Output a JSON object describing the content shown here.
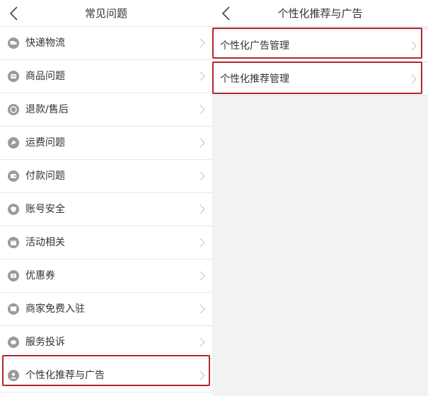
{
  "left": {
    "title": "常见问题",
    "items": [
      {
        "label": "快递物流",
        "icon": "truck-icon"
      },
      {
        "label": "商品问题",
        "icon": "product-icon"
      },
      {
        "label": "退款/售后",
        "icon": "refund-icon"
      },
      {
        "label": "运费问题",
        "icon": "shipping-fee-icon"
      },
      {
        "label": "付款问题",
        "icon": "wallet-icon"
      },
      {
        "label": "账号安全",
        "icon": "shield-icon"
      },
      {
        "label": "活动相关",
        "icon": "calendar-icon"
      },
      {
        "label": "优惠券",
        "icon": "coupon-icon"
      },
      {
        "label": "商家免费入驻",
        "icon": "store-icon"
      },
      {
        "label": "服务投诉",
        "icon": "chat-icon"
      },
      {
        "label": "个性化推荐与广告",
        "icon": "user-icon"
      }
    ]
  },
  "right": {
    "title": "个性化推荐与广告",
    "items": [
      {
        "label": "个性化广告管理"
      },
      {
        "label": "个性化推荐管理"
      }
    ]
  },
  "colors": {
    "highlight": "#b3262d",
    "icon_gray": "#9a9a9a",
    "divider": "#e8e8e8",
    "right_background": "#f2f2f2"
  }
}
